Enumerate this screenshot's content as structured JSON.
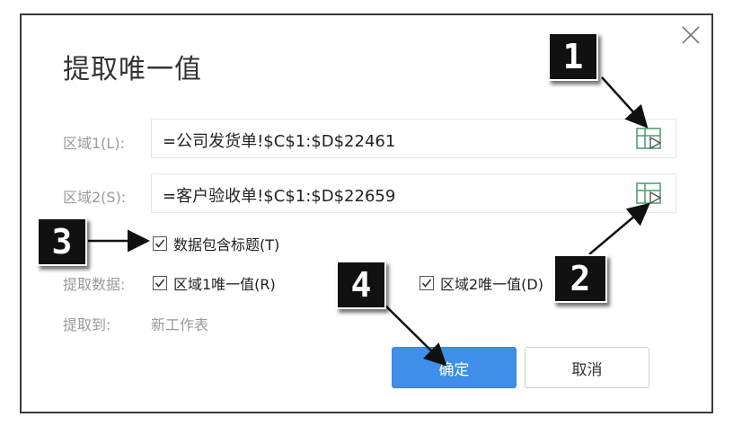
{
  "dialog": {
    "title": "提取唯一值",
    "range1": {
      "label": "区域1(L):",
      "value": "=公司发货单!$C$1:$D$22461"
    },
    "range2": {
      "label": "区域2(S):",
      "value": "=客户验收单!$C$1:$D$22659"
    },
    "header_checkbox": {
      "label": "数据包含标题(T)",
      "checked": true
    },
    "extract_data": {
      "label": "提取数据:",
      "option1": {
        "label": "区域1唯一值(R)",
        "checked": true
      },
      "option2": {
        "label": "区域2唯一值(D)",
        "checked": true
      }
    },
    "extract_to": {
      "label": "提取到:",
      "value": "新工作表"
    },
    "ok_label": "确定",
    "cancel_label": "取消"
  },
  "annotations": {
    "marker1": "1",
    "marker2": "2",
    "marker3": "3",
    "marker4": "4"
  },
  "colors": {
    "primary": "#3f8fe8",
    "icon_green": "#4a9a6a",
    "muted_text": "#9a9a9a"
  }
}
